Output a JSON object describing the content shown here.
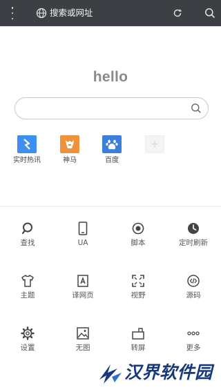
{
  "topbar": {
    "address_placeholder": "搜索或网址"
  },
  "home": {
    "greeting": "hello"
  },
  "shortcuts": [
    {
      "label": "实时热讯",
      "icon": "chevron-arrow-icon",
      "color": "#3d8ff0"
    },
    {
      "label": "神马",
      "icon": "shenma-horse-icon",
      "color": "#f0923a"
    },
    {
      "label": "百度",
      "icon": "baidu-paw-icon",
      "color": "#3b7fd8"
    },
    {
      "label": "",
      "icon": "add-shortcut-icon",
      "color": "#f4f4f4"
    }
  ],
  "menu": [
    {
      "label": "查找",
      "icon": "search-icon"
    },
    {
      "label": "UA",
      "icon": "phone-icon"
    },
    {
      "label": "脚本",
      "icon": "script-icon"
    },
    {
      "label": "定时刷新",
      "icon": "clock-icon"
    },
    {
      "label": "主题",
      "icon": "tshirt-icon"
    },
    {
      "label": "译网页",
      "icon": "translate-icon"
    },
    {
      "label": "视野",
      "icon": "fullscreen-icon"
    },
    {
      "label": "源码",
      "icon": "source-code-icon"
    },
    {
      "label": "设置",
      "icon": "gear-icon"
    },
    {
      "label": "无图",
      "icon": "no-image-icon"
    },
    {
      "label": "转屏",
      "icon": "rotate-screen-icon"
    },
    {
      "label": "更多",
      "icon": "more-dots-icon"
    }
  ],
  "watermark": {
    "text": "汉界软件园"
  }
}
